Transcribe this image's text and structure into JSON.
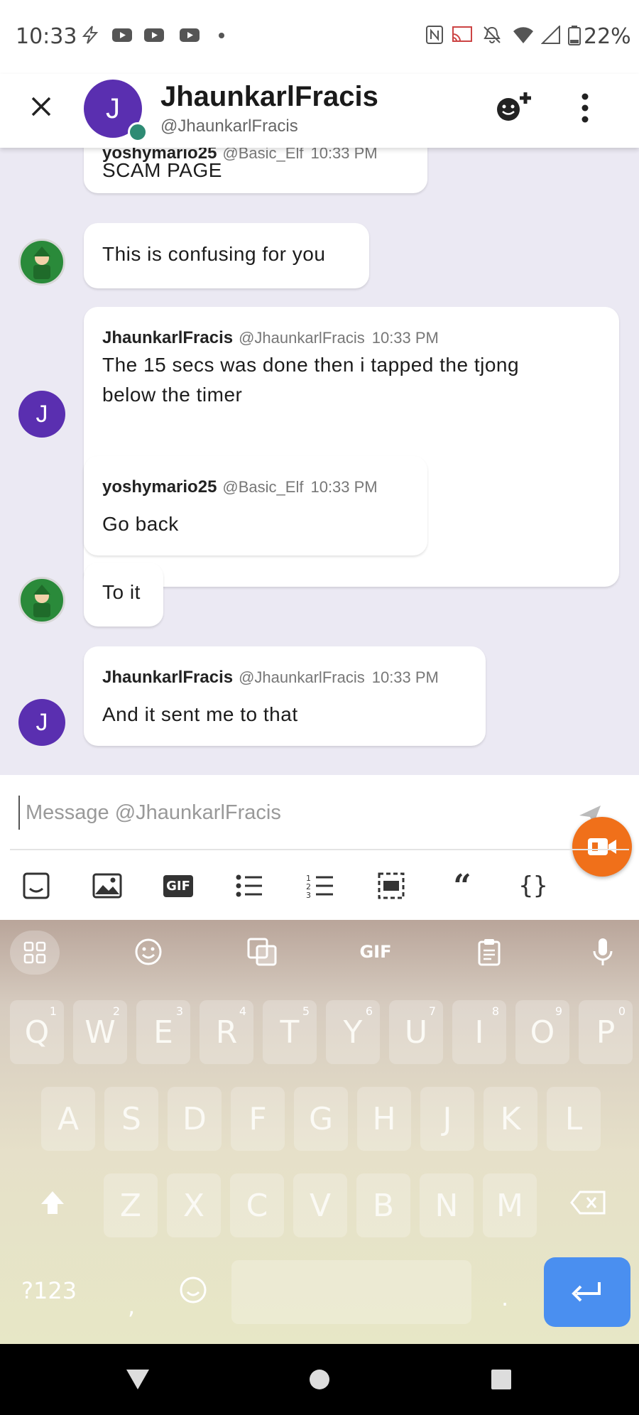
{
  "status_bar": {
    "time": "10:33",
    "battery": "22%"
  },
  "header": {
    "close_icon": "close-icon",
    "avatar_letter": "J",
    "name": "JhaunkarlFracis",
    "handle": "@JhaunkarlFracis",
    "add_friend_icon": "add-friend-icon",
    "menu_icon": "more-vertical-icon"
  },
  "messages": [
    {
      "author": "yoshymario25",
      "handle": "@Basic_Elf",
      "time": "10:33 PM",
      "text": "SCAM PAGE"
    },
    {
      "text": "This is confusing for you"
    },
    {
      "author": "JhaunkarlFracis",
      "handle": "@JhaunkarlFracis",
      "time": "10:33 PM",
      "text": "The 15 secs was done then i tapped the tjong",
      "text2": "below the timer",
      "avatar_letter": "J"
    },
    {
      "author": "yoshymario25",
      "handle": "@Basic_Elf",
      "time": "10:33 PM",
      "text": "Go back"
    },
    {
      "text": "To it"
    },
    {
      "author": "JhaunkarlFracis",
      "handle": "@JhaunkarlFracis",
      "time": "10:33 PM",
      "text": "And it sent me to that",
      "avatar_letter": "J"
    }
  ],
  "composer": {
    "placeholder": "Message @JhaunkarlFracis",
    "toolbar": [
      "emoji-icon",
      "image-icon",
      "gif-icon",
      "bulleted-list-icon",
      "numbered-list-icon",
      "spoiler-icon",
      "quote-icon",
      "code-block-icon"
    ],
    "gif_label": "GIF",
    "quote_label": "“",
    "code_label": "{}"
  },
  "keyboard": {
    "top_row_gif": "GIF",
    "row1": [
      {
        "key": "Q",
        "hint": "1"
      },
      {
        "key": "W",
        "hint": "2"
      },
      {
        "key": "E",
        "hint": "3"
      },
      {
        "key": "R",
        "hint": "4"
      },
      {
        "key": "T",
        "hint": "5"
      },
      {
        "key": "Y",
        "hint": "6"
      },
      {
        "key": "U",
        "hint": "7"
      },
      {
        "key": "I",
        "hint": "8"
      },
      {
        "key": "O",
        "hint": "9"
      },
      {
        "key": "P",
        "hint": "0"
      }
    ],
    "row2": [
      "A",
      "S",
      "D",
      "F",
      "G",
      "H",
      "J",
      "K",
      "L"
    ],
    "row3": [
      "Z",
      "X",
      "C",
      "V",
      "B",
      "N",
      "M"
    ],
    "symbols": "?123",
    "comma": ",",
    "period": "."
  },
  "colors": {
    "accent": "#5a2fb0",
    "online": "#2e8b74",
    "record": "#f0701a",
    "enter_key": "#4a8ff0"
  }
}
